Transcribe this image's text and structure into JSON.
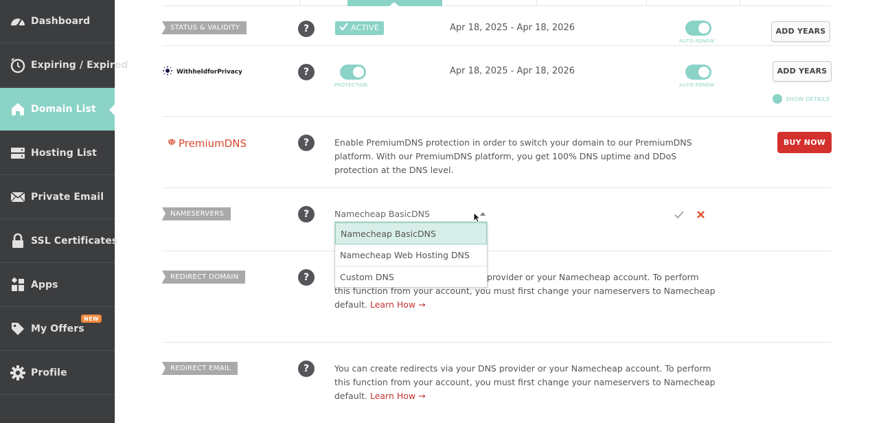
{
  "sidebar": {
    "items": [
      {
        "label": "Dashboard",
        "icon": "gauge-icon"
      },
      {
        "label": "Expiring / Expired",
        "icon": "timer-icon"
      },
      {
        "label": "Domain List",
        "icon": "home-icon",
        "active": true
      },
      {
        "label": "Hosting List",
        "icon": "server-icon"
      },
      {
        "label": "Private Email",
        "icon": "envelope-icon"
      },
      {
        "label": "SSL Certificates",
        "icon": "lock-icon"
      },
      {
        "label": "Apps",
        "icon": "apps-grid-icon"
      },
      {
        "label": "My Offers",
        "icon": "tag-icon",
        "badge": "NEW"
      },
      {
        "label": "Profile",
        "icon": "gear-icon"
      }
    ]
  },
  "status": {
    "tag": "STATUS & VALIDITY",
    "badge": "ACTIVE",
    "dates": "Apr 18, 2025 - Apr 18, 2026",
    "toggle_caption": "AUTO-RENEW",
    "button": "ADD YEARS"
  },
  "privacy": {
    "logo_text": "WithheldforPrivacy",
    "toggle_caption": "PROTECTION",
    "dates": "Apr 18, 2025 - Apr 18, 2026",
    "renew_caption": "AUTO-RENEW",
    "button": "ADD YEARS",
    "show_details": "SHOW DETAILS"
  },
  "premium": {
    "logo_text": "PremiumDNS",
    "description": "Enable PremiumDNS protection in order to switch your domain to our PremiumDNS platform. With our PremiumDNS platform, you get 100% DNS uptime and DDoS protection at the DNS level.",
    "button": "BUY NOW"
  },
  "nameservers": {
    "tag": "NAMESERVERS",
    "selected": "Namecheap BasicDNS",
    "options": [
      "Namecheap BasicDNS",
      "Namecheap Web Hosting DNS",
      "Custom DNS"
    ]
  },
  "redirect_domain": {
    "tag": "REDIRECT DOMAIN",
    "text_line1_tail": "provider or your Namecheap account. To perform",
    "text_line2": "this function from your account, you must first change your nameservers to Namecheap",
    "text_line3": "default.",
    "link": "Learn How →"
  },
  "redirect_email": {
    "tag": "REDIRECT EMAIL",
    "text_line1": "You can create redirects via your DNS provider or your Namecheap account. To perform",
    "text_line2": "this function from your account, you must first change your nameservers to Namecheap",
    "text_line3": "default.",
    "link": "Learn How →"
  },
  "colors": {
    "accent": "#8ad3c6",
    "sidebar_bg": "#3c3d3f",
    "danger": "#d4302d"
  },
  "help_symbol": "?"
}
